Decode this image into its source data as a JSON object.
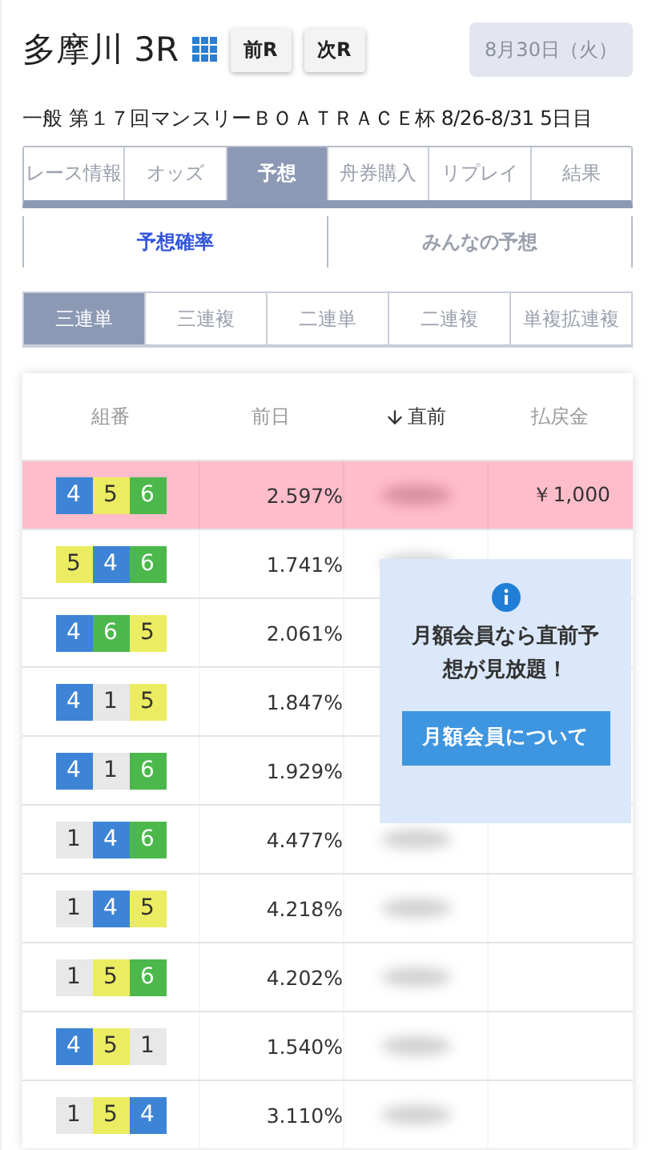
{
  "header": {
    "title": "多摩川 3R",
    "prev_button": "前R",
    "next_button": "次R",
    "date": "8月30日（火）"
  },
  "race_name": "一般 第１７回マンスリーＢＯＡＴＲＡＣＥ杯 8/26-8/31 5日目",
  "tabs": [
    {
      "label": "レース情報",
      "selected": false
    },
    {
      "label": "オッズ",
      "selected": false
    },
    {
      "label": "予想",
      "selected": true
    },
    {
      "label": "舟券購入",
      "selected": false
    },
    {
      "label": "リプレイ",
      "selected": false
    },
    {
      "label": "結果",
      "selected": false
    }
  ],
  "sub_tabs": [
    {
      "label": "予想確率",
      "selected": true
    },
    {
      "label": "みんなの予想",
      "selected": false
    }
  ],
  "bet_types": [
    {
      "label": "三連単",
      "selected": true
    },
    {
      "label": "三連複",
      "selected": false
    },
    {
      "label": "二連単",
      "selected": false
    },
    {
      "label": "二連複",
      "selected": false
    },
    {
      "label": "単複拡連複",
      "selected": false
    }
  ],
  "table": {
    "columns": [
      {
        "label": "組番",
        "sorted": false
      },
      {
        "label": "前日",
        "sorted": false
      },
      {
        "label": "直前",
        "sorted": true
      },
      {
        "label": "払戻金",
        "sorted": false
      }
    ],
    "rows": [
      {
        "boats": [
          {
            "n": "4",
            "color": "#3d84d6"
          },
          {
            "n": "5",
            "color": "#ecec62"
          },
          {
            "n": "6",
            "color": "#4cb84c"
          }
        ],
        "prev_day": "2.597%",
        "payout": "￥1,000",
        "highlighted": true
      },
      {
        "boats": [
          {
            "n": "5",
            "color": "#ecec62"
          },
          {
            "n": "4",
            "color": "#3d84d6"
          },
          {
            "n": "6",
            "color": "#4cb84c"
          }
        ],
        "prev_day": "1.741%",
        "highlighted": false
      },
      {
        "boats": [
          {
            "n": "4",
            "color": "#3d84d6"
          },
          {
            "n": "6",
            "color": "#4cb84c"
          },
          {
            "n": "5",
            "color": "#ecec62"
          }
        ],
        "prev_day": "2.061%",
        "highlighted": false,
        "blurred_shown": false
      },
      {
        "boats": [
          {
            "n": "4",
            "color": "#3d84d6"
          },
          {
            "n": "1",
            "color": "#e8e8e8"
          },
          {
            "n": "5",
            "color": "#ecec62"
          }
        ],
        "prev_day": "1.847%",
        "highlighted": false,
        "blurred_shown": false
      },
      {
        "boats": [
          {
            "n": "4",
            "color": "#3d84d6"
          },
          {
            "n": "1",
            "color": "#e8e8e8"
          },
          {
            "n": "6",
            "color": "#4cb84c"
          }
        ],
        "prev_day": "1.929%",
        "highlighted": false,
        "blurred_shown": false
      },
      {
        "boats": [
          {
            "n": "1",
            "color": "#e8e8e8"
          },
          {
            "n": "4",
            "color": "#3d84d6"
          },
          {
            "n": "6",
            "color": "#4cb84c"
          }
        ],
        "prev_day": "4.477%",
        "highlighted": false
      },
      {
        "boats": [
          {
            "n": "1",
            "color": "#e8e8e8"
          },
          {
            "n": "4",
            "color": "#3d84d6"
          },
          {
            "n": "5",
            "color": "#ecec62"
          }
        ],
        "prev_day": "4.218%",
        "highlighted": false
      },
      {
        "boats": [
          {
            "n": "1",
            "color": "#e8e8e8"
          },
          {
            "n": "5",
            "color": "#ecec62"
          },
          {
            "n": "6",
            "color": "#4cb84c"
          }
        ],
        "prev_day": "4.202%",
        "highlighted": false
      },
      {
        "boats": [
          {
            "n": "4",
            "color": "#3d84d6"
          },
          {
            "n": "5",
            "color": "#ecec62"
          },
          {
            "n": "1",
            "color": "#e8e8e8"
          }
        ],
        "prev_day": "1.540%",
        "highlighted": false
      },
      {
        "boats": [
          {
            "n": "1",
            "color": "#e8e8e8"
          },
          {
            "n": "5",
            "color": "#ecec62"
          },
          {
            "n": "4",
            "color": "#3d84d6"
          }
        ],
        "prev_day": "3.110%",
        "highlighted": false
      }
    ]
  },
  "member_popup": {
    "message": "月額会員なら直前予想が見放題！",
    "button": "月額会員について"
  }
}
